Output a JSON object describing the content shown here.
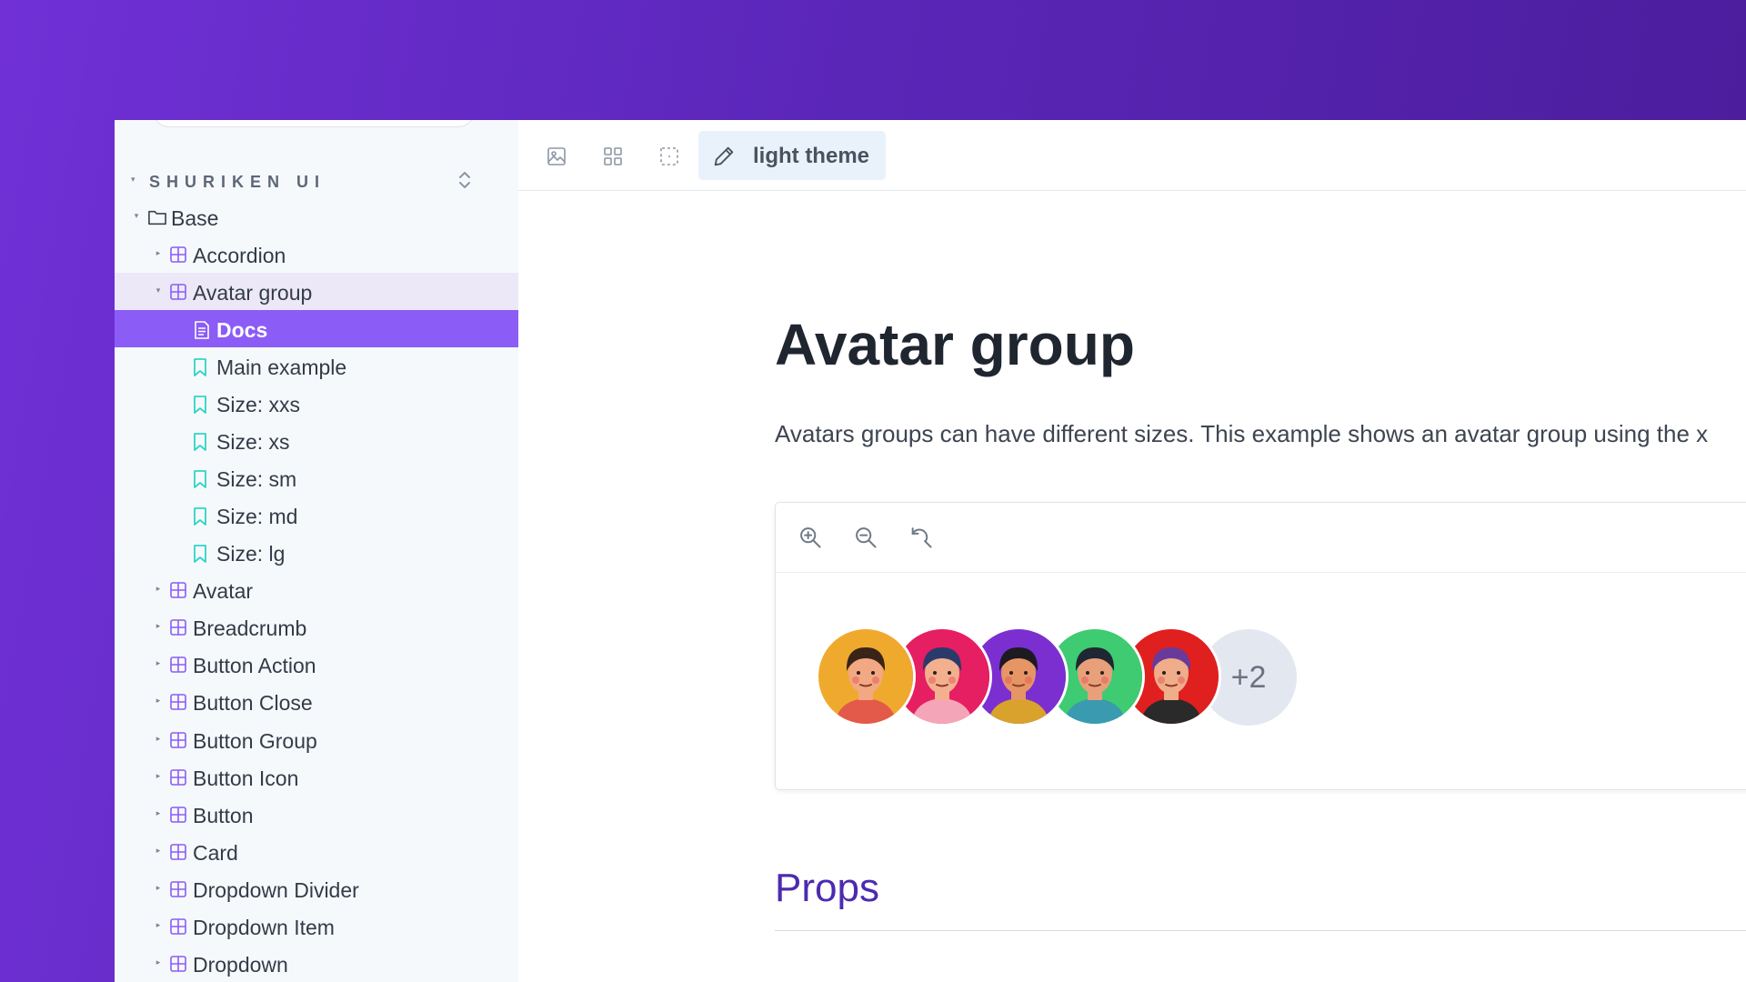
{
  "sidebar": {
    "root": "SHURIKEN UI",
    "tree": [
      {
        "label": "Base",
        "level": 0,
        "kind": "folder",
        "caret": "▾"
      },
      {
        "label": "Accordion",
        "level": 1,
        "kind": "component",
        "caret": "▸"
      },
      {
        "label": "Avatar group",
        "level": 1,
        "kind": "component",
        "caret": "▾",
        "state": "selected"
      },
      {
        "label": "Docs",
        "level": 2,
        "kind": "doc",
        "caret": "",
        "state": "active"
      },
      {
        "label": "Main example",
        "level": 2,
        "kind": "story",
        "caret": ""
      },
      {
        "label": "Size: xxs",
        "level": 2,
        "kind": "story",
        "caret": ""
      },
      {
        "label": "Size: xs",
        "level": 2,
        "kind": "story",
        "caret": ""
      },
      {
        "label": "Size: sm",
        "level": 2,
        "kind": "story",
        "caret": ""
      },
      {
        "label": "Size: md",
        "level": 2,
        "kind": "story",
        "caret": ""
      },
      {
        "label": "Size: lg",
        "level": 2,
        "kind": "story",
        "caret": ""
      },
      {
        "label": "Avatar",
        "level": 1,
        "kind": "component",
        "caret": "▸"
      },
      {
        "label": "Breadcrumb",
        "level": 1,
        "kind": "component",
        "caret": "▸"
      },
      {
        "label": "Button Action",
        "level": 1,
        "kind": "component",
        "caret": "▸"
      },
      {
        "label": "Button Close",
        "level": 1,
        "kind": "component",
        "caret": "▸"
      },
      {
        "label": "Button Group",
        "level": 1,
        "kind": "component",
        "caret": "▸"
      },
      {
        "label": "Button Icon",
        "level": 1,
        "kind": "component",
        "caret": "▸"
      },
      {
        "label": "Button",
        "level": 1,
        "kind": "component",
        "caret": "▸"
      },
      {
        "label": "Card",
        "level": 1,
        "kind": "component",
        "caret": "▸"
      },
      {
        "label": "Dropdown Divider",
        "level": 1,
        "kind": "component",
        "caret": "▸"
      },
      {
        "label": "Dropdown Item",
        "level": 1,
        "kind": "component",
        "caret": "▸"
      },
      {
        "label": "Dropdown",
        "level": 1,
        "kind": "component",
        "caret": "▸"
      }
    ]
  },
  "toolbar": {
    "icons": [
      "image-icon",
      "grid-icon",
      "outline-icon"
    ],
    "theme_label": "light theme"
  },
  "main": {
    "title": "Avatar group",
    "description": "Avatars groups can have different sizes. This example shows an avatar group using the x",
    "canvas_tools": [
      "zoom-in-icon",
      "zoom-out-icon",
      "zoom-reset-icon"
    ],
    "props_heading": "Props"
  },
  "avatars": {
    "items": [
      {
        "name": "avatar-1",
        "bg": "#efaa2e",
        "skin": "#f2a883",
        "hair": "#3a2418",
        "shirt": "#e35a4a"
      },
      {
        "name": "avatar-2",
        "bg": "#e61e62",
        "skin": "#f3b08f",
        "hair": "#2a3a6b",
        "shirt": "#f4a6b8"
      },
      {
        "name": "avatar-3",
        "bg": "#7b2fd0",
        "skin": "#e69565",
        "hair": "#1e1a22",
        "shirt": "#d8a22c"
      },
      {
        "name": "avatar-4",
        "bg": "#3ecb72",
        "skin": "#e8a07a",
        "hair": "#1f2733",
        "shirt": "#3a9ab0"
      },
      {
        "name": "avatar-5",
        "bg": "#e01f1f",
        "skin": "#f0ad8a",
        "hair": "#6a3a9a",
        "shirt": "#2a2a2a"
      }
    ],
    "more_label": "+2"
  },
  "colors": {
    "accent": "#8b5cf6",
    "bookmark": "#2fd5c5",
    "component_icon": "#8a5cf5",
    "heading": "#4c2ab0"
  }
}
